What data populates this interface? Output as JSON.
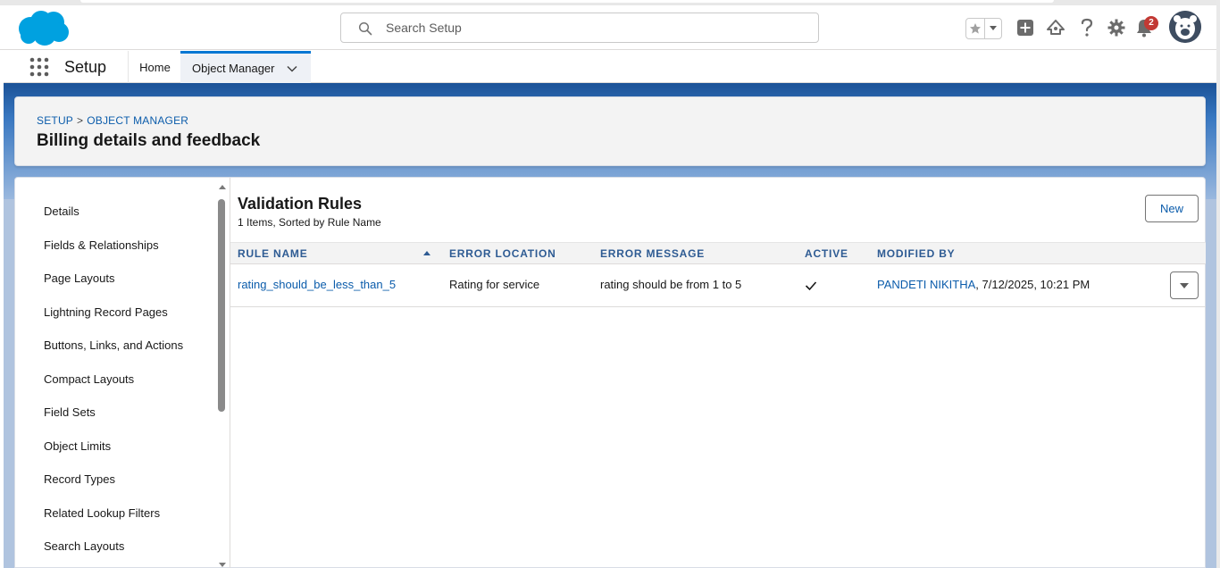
{
  "header": {
    "search_placeholder": "Search Setup",
    "notification_count": "2",
    "icons": [
      "salesforce-cloud-logo",
      "search-icon",
      "star-icon",
      "chevron-down-icon",
      "plus-icon",
      "trailhead-icon",
      "help-icon",
      "gear-icon",
      "bell-icon",
      "avatar"
    ]
  },
  "context_bar": {
    "app_name": "Setup",
    "tabs": [
      {
        "label": "Home"
      },
      {
        "label": "Object Manager"
      }
    ]
  },
  "page_header": {
    "breadcrumb": [
      "SETUP",
      ">",
      "OBJECT MANAGER"
    ],
    "title": "Billing details and feedback"
  },
  "sidebar": {
    "items": [
      {
        "label": "Details"
      },
      {
        "label": "Fields & Relationships"
      },
      {
        "label": "Page Layouts"
      },
      {
        "label": "Lightning Record Pages"
      },
      {
        "label": "Buttons, Links, and Actions"
      },
      {
        "label": "Compact Layouts"
      },
      {
        "label": "Field Sets"
      },
      {
        "label": "Object Limits"
      },
      {
        "label": "Record Types"
      },
      {
        "label": "Related Lookup Filters"
      },
      {
        "label": "Search Layouts"
      }
    ]
  },
  "list": {
    "title": "Validation Rules",
    "subtitle": "1 Items, Sorted by Rule Name",
    "new_label": "New",
    "columns": [
      "RULE NAME",
      "ERROR LOCATION",
      "ERROR MESSAGE",
      "ACTIVE",
      "MODIFIED BY"
    ],
    "rows": [
      {
        "rule_name": "rating_should_be_less_than_5",
        "error_location": "Rating for service",
        "error_message": "rating should be from 1 to 5",
        "active": true,
        "modified_by_user": "PANDETI NIKITHA",
        "modified_by_date": ", 7/12/2025, 10:21 PM"
      }
    ]
  },
  "colors": {
    "brand_blue": "#0176d3",
    "link_blue": "#0b5cab",
    "header_text_blue": "#2e5b93",
    "badge_red": "#c23934"
  }
}
